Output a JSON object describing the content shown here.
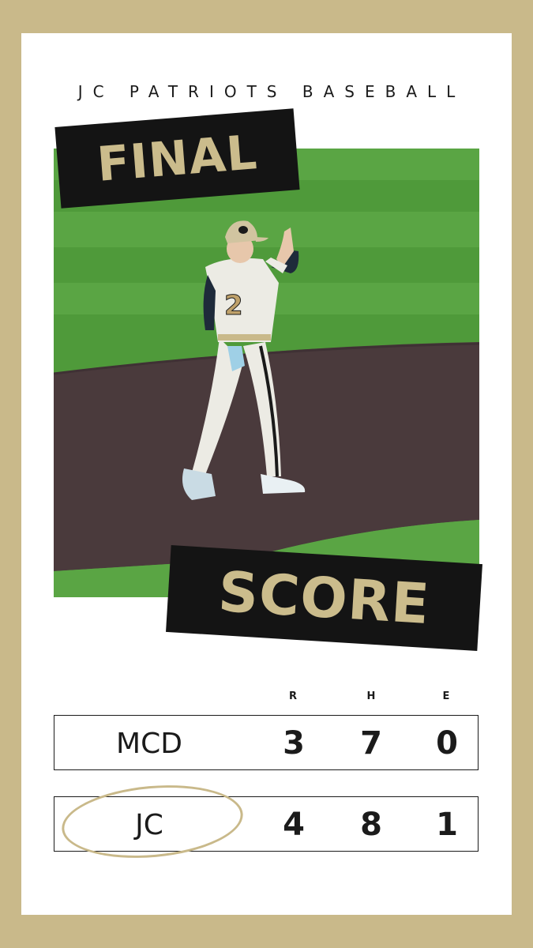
{
  "header": {
    "title": "JC PATRIOTS BASEBALL"
  },
  "banners": {
    "top": "FINAL",
    "bottom": "SCORE"
  },
  "scoreboard": {
    "columns": [
      "R",
      "H",
      "E"
    ],
    "rows": [
      {
        "team": "MCD",
        "values": [
          "3",
          "7",
          "0"
        ]
      },
      {
        "team": "JC",
        "values": [
          "4",
          "8",
          "1"
        ],
        "highlighted": true
      }
    ]
  },
  "photo": {
    "description_icon": "baseball-player-photo",
    "jersey_number": "2"
  },
  "colors": {
    "frame": "#c9b98a",
    "banner_background": "#141414",
    "banner_text": "#cbbc8c",
    "highlight_ellipse": "#c9b98a"
  }
}
